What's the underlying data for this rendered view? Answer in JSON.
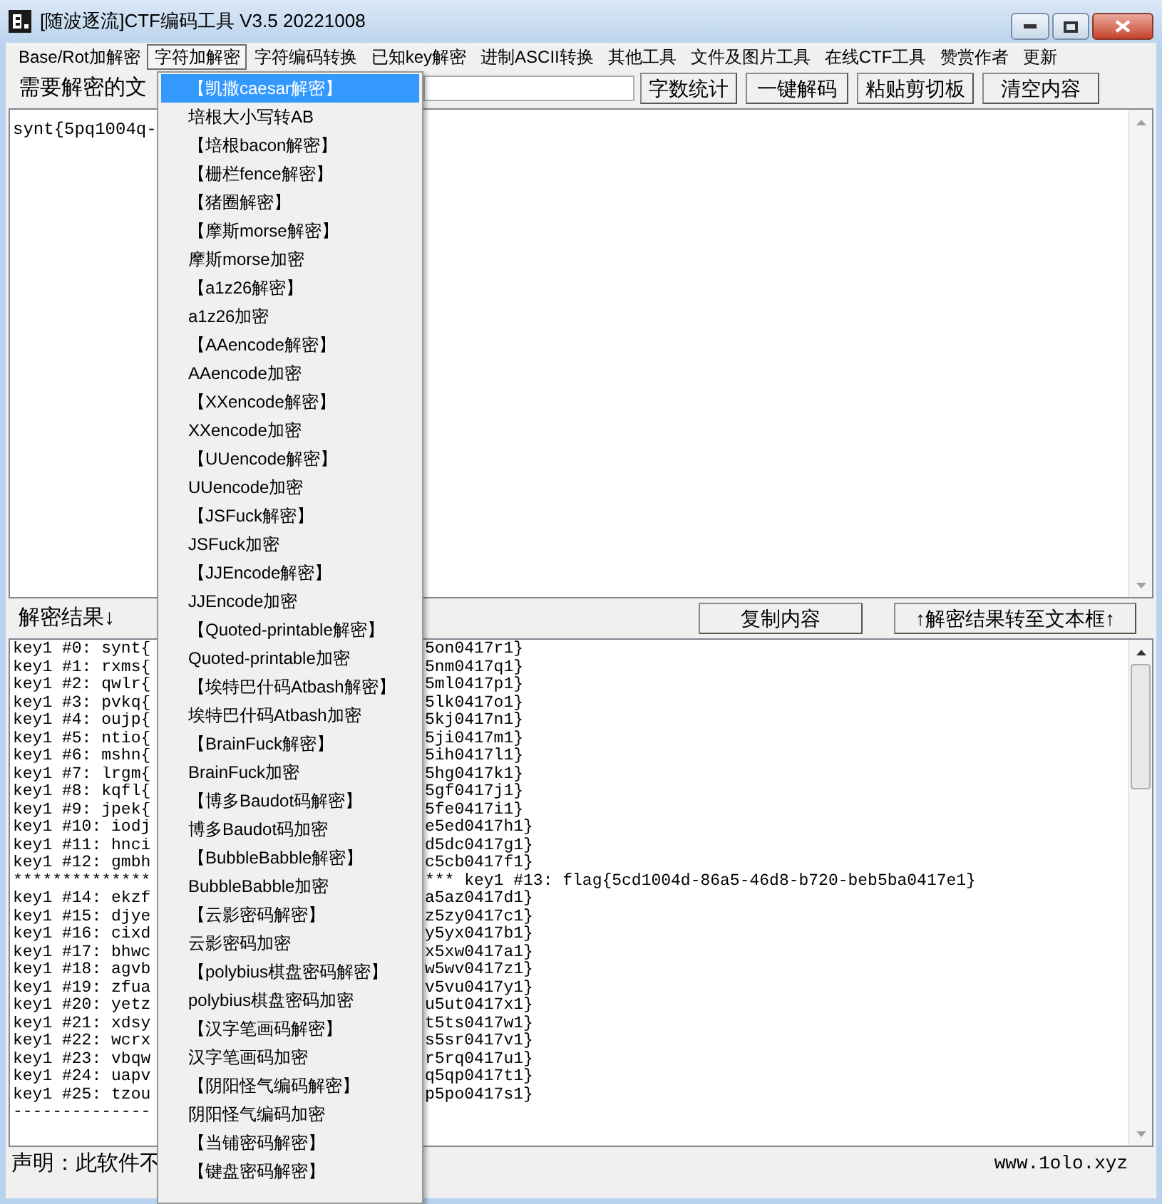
{
  "window": {
    "title": "[随波逐流]CTF编码工具 V3.5 20221008"
  },
  "menu_bar": [
    {
      "label": "Base/Rot加解密",
      "selected": false
    },
    {
      "label": "字符加解密",
      "selected": true
    },
    {
      "label": "字符编码转换",
      "selected": false
    },
    {
      "label": "已知key解密",
      "selected": false
    },
    {
      "label": "进制ASCII转换",
      "selected": false
    },
    {
      "label": "其他工具",
      "selected": false
    },
    {
      "label": "文件及图片工具",
      "selected": false
    },
    {
      "label": "在线CTF工具",
      "selected": false
    },
    {
      "label": "赞赏作者",
      "selected": false
    },
    {
      "label": "更新",
      "selected": false
    }
  ],
  "input_section": {
    "label": "需要解密的文",
    "buttons": [
      "字数统计",
      "一键解码",
      "粘贴剪切板",
      "清空内容"
    ],
    "text": "synt{5pq1004q-"
  },
  "result_section": {
    "label": "解密结果↓",
    "buttons": [
      "复制内容",
      "↑解密结果转至文本框↑"
    ],
    "lines": [
      {
        "left": "key1 #0: synt{",
        "right": "5on0417r1}"
      },
      {
        "left": "key1 #1: rxms{",
        "right": "5nm0417q1}"
      },
      {
        "left": "key1 #2: qwlr{",
        "right": "5ml0417p1}"
      },
      {
        "left": "key1 #3: pvkq{",
        "right": "5lk0417o1}"
      },
      {
        "left": "key1 #4: oujp{",
        "right": "5kj0417n1}"
      },
      {
        "left": "key1 #5: ntio{",
        "right": "5ji0417m1}"
      },
      {
        "left": "key1 #6: mshn{",
        "right": "5ih0417l1}"
      },
      {
        "left": "key1 #7: lrgm{",
        "right": "5hg0417k1}"
      },
      {
        "left": "key1 #8: kqfl{",
        "right": "5gf0417j1}"
      },
      {
        "left": "key1 #9: jpek{",
        "right": "5fe0417i1}"
      },
      {
        "left": "key1 #10: iodj",
        "right": "e5ed0417h1}"
      },
      {
        "left": "key1 #11: hnci",
        "right": "d5dc0417g1}"
      },
      {
        "left": "key1 #12: gmbh",
        "right": "c5cb0417f1}"
      },
      {
        "left": "**************",
        "right": "*** key1 #13: flag{5cd1004d-86a5-46d8-b720-beb5ba0417e1}"
      },
      {
        "left": "key1 #14: ekzf",
        "right": "a5az0417d1}"
      },
      {
        "left": "key1 #15: djye",
        "right": "z5zy0417c1}"
      },
      {
        "left": "key1 #16: cixd",
        "right": "y5yx0417b1}"
      },
      {
        "left": "key1 #17: bhwc",
        "right": "x5xw0417a1}"
      },
      {
        "left": "key1 #18: agvb",
        "right": "w5wv0417z1}"
      },
      {
        "left": "key1 #19: zfua",
        "right": "v5vu0417y1}"
      },
      {
        "left": "key1 #20: yetz",
        "right": "u5ut0417x1}"
      },
      {
        "left": "key1 #21: xdsy",
        "right": "t5ts0417w1}"
      },
      {
        "left": "key1 #22: wcrx",
        "right": "s5sr0417v1}"
      },
      {
        "left": "key1 #23: vbqw",
        "right": "r5rq0417u1}"
      },
      {
        "left": "key1 #24: uapv",
        "right": "q5qp0417t1}"
      },
      {
        "left": "key1 #25: tzou",
        "right": "p5po0417s1}"
      },
      {
        "left": "--------------"
      }
    ]
  },
  "status_bar": {
    "notice": "声明：此软件不",
    "website": "www.1olo.xyz"
  },
  "dropdown_menu": {
    "items": [
      {
        "label": "【凯撒caesar解密】",
        "selected": true
      },
      {
        "label": "培根大小写转AB",
        "selected": false
      },
      {
        "label": "【培根bacon解密】",
        "selected": false
      },
      {
        "label": "【栅栏fence解密】",
        "selected": false
      },
      {
        "label": "【猪圈解密】",
        "selected": false
      },
      {
        "label": "【摩斯morse解密】",
        "selected": false
      },
      {
        "label": "摩斯morse加密",
        "selected": false
      },
      {
        "label": "【a1z26解密】",
        "selected": false
      },
      {
        "label": "a1z26加密",
        "selected": false
      },
      {
        "label": "【AAencode解密】",
        "selected": false
      },
      {
        "label": "AAencode加密",
        "selected": false
      },
      {
        "label": "【XXencode解密】",
        "selected": false
      },
      {
        "label": "XXencode加密",
        "selected": false
      },
      {
        "label": "【UUencode解密】",
        "selected": false
      },
      {
        "label": "UUencode加密",
        "selected": false
      },
      {
        "label": "【JSFuck解密】",
        "selected": false
      },
      {
        "label": "JSFuck加密",
        "selected": false
      },
      {
        "label": "【JJEncode解密】",
        "selected": false
      },
      {
        "label": "JJEncode加密",
        "selected": false
      },
      {
        "label": "【Quoted-printable解密】",
        "selected": false
      },
      {
        "label": "Quoted-printable加密",
        "selected": false
      },
      {
        "label": "【埃特巴什码Atbash解密】",
        "selected": false
      },
      {
        "label": "埃特巴什码Atbash加密",
        "selected": false
      },
      {
        "label": "【BrainFuck解密】",
        "selected": false
      },
      {
        "label": "BrainFuck加密",
        "selected": false
      },
      {
        "label": "【博多Baudot码解密】",
        "selected": false
      },
      {
        "label": "博多Baudot码加密",
        "selected": false
      },
      {
        "label": "【BubbleBabble解密】",
        "selected": false
      },
      {
        "label": "BubbleBabble加密",
        "selected": false
      },
      {
        "label": "【云影密码解密】",
        "selected": false
      },
      {
        "label": "云影密码加密",
        "selected": false
      },
      {
        "label": "【polybius棋盘密码解密】",
        "selected": false
      },
      {
        "label": "polybius棋盘密码加密",
        "selected": false
      },
      {
        "label": "【汉字笔画码解密】",
        "selected": false
      },
      {
        "label": "汉字笔画码加密",
        "selected": false
      },
      {
        "label": "【阴阳怪气编码解密】",
        "selected": false
      },
      {
        "label": "阴阳怪气编码加密",
        "selected": false
      },
      {
        "label": "【当铺密码解密】",
        "selected": false
      },
      {
        "label": "【键盘密码解密】",
        "selected": false
      }
    ]
  }
}
